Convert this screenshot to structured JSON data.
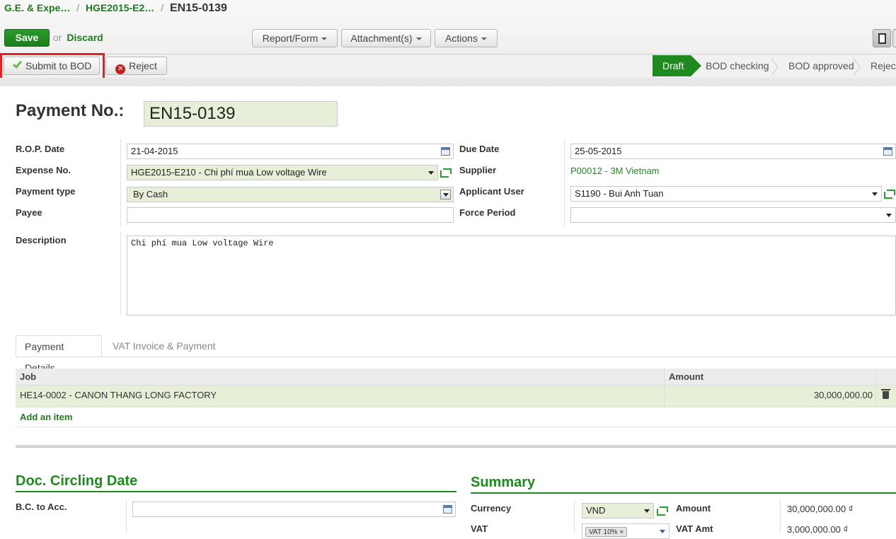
{
  "breadcrumb": {
    "items": [
      "G.E. & Expe…",
      "HGE2015-E2…"
    ],
    "current": "EN15-0139",
    "separator": "/"
  },
  "toolbar": {
    "save_label": "Save",
    "or_text": "or",
    "discard_label": "Discard",
    "report_label": "Report/Form",
    "attachments_label": "Attachment(s)",
    "actions_label": "Actions"
  },
  "workflow": {
    "submit_label": "Submit to BOD",
    "reject_label": "Reject",
    "states": [
      "Draft",
      "BOD checking",
      "BOD approved",
      "Reject"
    ],
    "active_state": "Draft"
  },
  "form": {
    "payment_no_label": "Payment No.:",
    "payment_no": "EN15-0139",
    "rop_date_label": "R.O.P. Date",
    "rop_date": "21-04-2015",
    "expense_no_label": "Expense No.",
    "expense_no": "HGE2015-E210 - Chi phí  mua Low voltage Wire",
    "payment_type_label": "Payment type",
    "payment_type": "By Cash",
    "payee_label": "Payee",
    "payee": "",
    "due_date_label": "Due Date",
    "due_date": "25-05-2015",
    "supplier_label": "Supplier",
    "supplier": "P00012 - 3M Vietnam",
    "applicant_label": "Applicant User",
    "applicant": "S1190 - Bui Anh Tuan",
    "force_period_label": "Force Period",
    "force_period": "",
    "description_label": "Description",
    "description": "Chi phí  mua Low voltage Wire"
  },
  "tabs": [
    "Payment Details",
    "VAT Invoice & Payment"
  ],
  "details_table": {
    "headers": [
      "Job",
      "Amount"
    ],
    "rows": [
      {
        "job": "HE14-0002 - CANON THANG LONG FACTORY",
        "amount": "30,000,000.00"
      }
    ],
    "add_item_label": "Add an item"
  },
  "doc_circling": {
    "title": "Doc. Circling Date",
    "bc_to_acc_label": "B.C. to Acc.",
    "bc_to_acc": ""
  },
  "summary": {
    "title": "Summary",
    "currency_label": "Currency",
    "currency": "VND",
    "vat_label": "VAT",
    "vat_tag": "VAT 10%",
    "amount_label": "Amount",
    "amount": "30,000,000.00 ₫",
    "vat_amt_label": "VAT Amt",
    "vat_amt": "3,000,000.00 ₫"
  },
  "colors": {
    "accent": "#1f8a1f",
    "required_field": "#e8efd8",
    "highlight": "#e32222"
  }
}
